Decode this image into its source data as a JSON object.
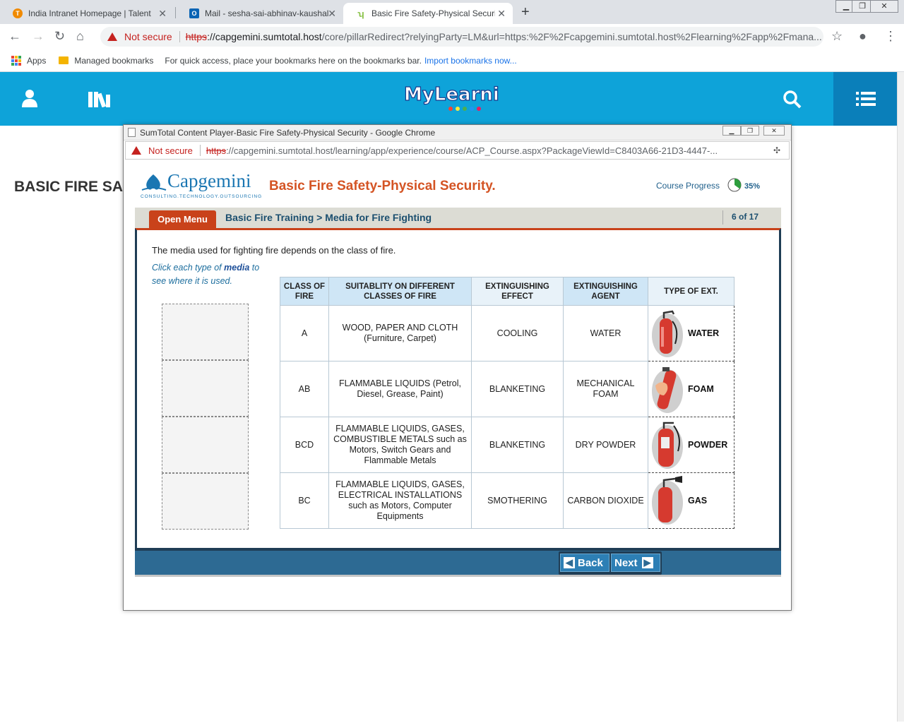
{
  "browser": {
    "tabs": [
      {
        "title": "India Intranet Homepage | Talent",
        "favicon_color": "#f08a00",
        "favicon_letter": "T"
      },
      {
        "title": "Mail - sesha-sai-abhinav-kaushal",
        "favicon_color": "#0a64b4",
        "favicon_letter": "O"
      },
      {
        "title": "Basic Fire Safety-Physical Security",
        "favicon_color": "#8bc34a",
        "favicon_letter": ""
      }
    ],
    "address": {
      "security": "Not secure",
      "scheme": "https",
      "host": "://capgemini.sumtotal.host",
      "path": "/core/pillarRedirect?relyingParty=LM&url=https:%2F%2Fcapgemini.sumtotal.host%2Flearning%2Fapp%2Fmana..."
    },
    "bookmarks": {
      "apps": "Apps",
      "managed": "Managed bookmarks",
      "hint": "For quick access, place your bookmarks here on the bookmarks bar.",
      "import": "Import bookmarks now..."
    }
  },
  "header": {
    "logo_text": "MyLearning",
    "brand_color": "#0ea3d9"
  },
  "page": {
    "title": "BASIC FIRE SAFETY-PHYSICAL SECURITY"
  },
  "popup": {
    "window_title": "SumTotal Content Player-Basic Fire Safety-Physical Security - Google Chrome",
    "security": "Not secure",
    "scheme": "https",
    "url_host": "://capgemini.sumtotal.host",
    "url_path": "/learning/app/experience/course/ACP_Course.aspx?PackageViewId=C8403A66-21D3-4447-..."
  },
  "course": {
    "brand": "Capgemini",
    "brand_tagline": "CONSULTING.TECHNOLOGY.OUTSOURCING",
    "title": "Basic Fire Safety-Physical Security.",
    "progress_label": "Course Progress",
    "progress_value": "35%",
    "progress_fraction": 0.35,
    "open_menu": "Open Menu",
    "breadcrumb": "Basic Fire Training > Media for Fire Fighting",
    "page_count": "6 of 17",
    "intro": "The media used for fighting fire depends on the class of fire.",
    "instruction_pre": "Click each type of ",
    "instruction_bold": "media",
    "instruction_post": " to see where it is used.",
    "table": {
      "headers": [
        "CLASS OF FIRE",
        "SUITABLITY ON DIFFERENT CLASSES OF FIRE",
        "EXTINGUISHING EFFECT",
        "EXTINGUISHING AGENT",
        "TYPE OF EXT."
      ],
      "rows": [
        {
          "class": "A",
          "suitability": "WOOD, PAPER AND CLOTH (Furniture, Carpet)",
          "effect": "COOLING",
          "agent": "WATER",
          "ext_type": "WATER"
        },
        {
          "class": "AB",
          "suitability": "FLAMMABLE LIQUIDS (Petrol, Diesel, Grease, Paint)",
          "effect": "BLANKETING",
          "agent": "MECHANICAL FOAM",
          "ext_type": "FOAM"
        },
        {
          "class": "BCD",
          "suitability": "FLAMMABLE LIQUIDS, GASES, COMBUSTIBLE METALS such as Motors, Switch Gears and Flammable Metals",
          "effect": "BLANKETING",
          "agent": "DRY POWDER",
          "ext_type": "POWDER"
        },
        {
          "class": "BC",
          "suitability": "FLAMMABLE LIQUIDS, GASES, ELECTRICAL INSTALLATIONS such as Motors, Computer Equipments",
          "effect": "SMOTHERING",
          "agent": "CARBON DIOXIDE",
          "ext_type": "GAS"
        }
      ]
    },
    "nav": {
      "back": "Back",
      "next": "Next"
    }
  }
}
